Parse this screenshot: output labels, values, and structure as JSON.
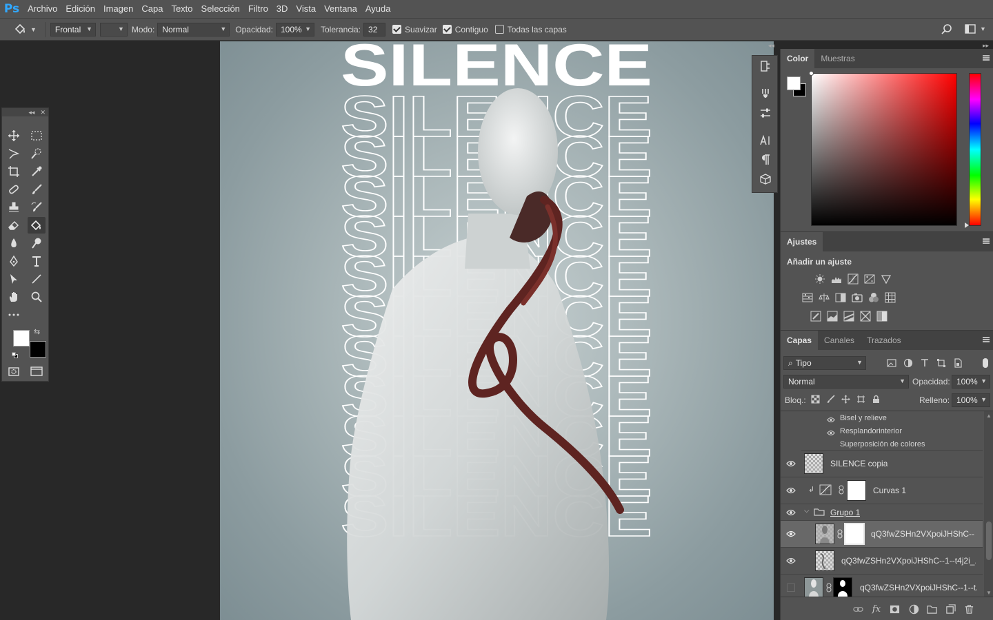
{
  "app": {
    "logo": "Ps"
  },
  "menu": [
    "Archivo",
    "Edición",
    "Imagen",
    "Capa",
    "Texto",
    "Selección",
    "Filtro",
    "3D",
    "Vista",
    "Ventana",
    "Ayuda"
  ],
  "options": {
    "fill_source": "Frontal",
    "mode_label": "Modo:",
    "mode_value": "Normal",
    "opacity_label": "Opacidad:",
    "opacity_value": "100%",
    "tolerance_label": "Tolerancia:",
    "tolerance_value": "32",
    "antialias_label": "Suavizar",
    "contiguous_label": "Contiguo",
    "all_layers_label": "Todas las capas",
    "antialias_checked": true,
    "contiguous_checked": true,
    "all_layers_checked": false
  },
  "canvas": {
    "title_text": "SILENCE",
    "outline_rows": 11,
    "background": "#a9b6b8"
  },
  "color_panel": {
    "tabs": [
      "Color",
      "Muestras"
    ],
    "active_tab": "Color",
    "foreground": "#ffffff",
    "background": "#000000"
  },
  "adjustments": {
    "tab": "Ajustes",
    "add_label": "Añadir un ajuste",
    "icons": [
      "brightness-contrast-icon",
      "levels-icon",
      "curves-icon",
      "exposure-icon",
      "vibrance-icon",
      "hue-saturation-icon",
      "color-balance-icon",
      "black-white-icon",
      "photo-filter-icon",
      "channel-mixer-icon",
      "color-lookup-icon",
      "invert-icon",
      "posterize-icon",
      "threshold-icon",
      "selective-color-icon",
      "gradient-map-icon"
    ]
  },
  "layers": {
    "tabs": [
      "Capas",
      "Canales",
      "Trazados"
    ],
    "active_tab": "Capas",
    "filter_label": "Tipo",
    "blend_mode": "Normal",
    "opacity_label": "Opacidad:",
    "opacity_value": "100%",
    "lock_label": "Bloq.:",
    "fill_label": "Relleno:",
    "fill_value": "100%",
    "effects": [
      "Bisel y relieve",
      "Resplandorinterior",
      "Superposición de colores"
    ],
    "rows": [
      {
        "name": "SILENCE copia",
        "visible": true
      },
      {
        "name": "Curvas 1",
        "visible": true
      },
      {
        "name": "Grupo 1",
        "visible": true
      },
      {
        "name": "qQ3fwZSHn2VXpoiJHShC--...",
        "visible": true
      },
      {
        "name": "qQ3fwZSHn2VXpoiJHShC--1--t4j2i_...",
        "visible": true
      },
      {
        "name": "qQ3fwZSHn2VXpoiJHShC--1--t...",
        "visible": false
      }
    ]
  }
}
